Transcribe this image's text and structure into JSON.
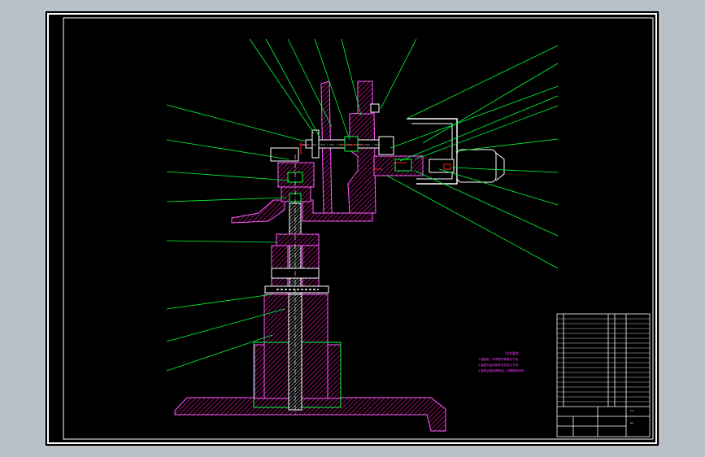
{
  "drawing": {
    "background": "#000000",
    "frame_color": "#ffffff",
    "leader_color": "#00ff3a",
    "section_color": "#b0127a",
    "outline_color": "#ff5cff",
    "part_color": "#ffffff",
    "dim_color": "#ff2020"
  },
  "tech_notes": {
    "title": "技术要求",
    "lines": [
      "1.装配前，所有零件需清洗干净。",
      "2.装配后运动部件应灵活无卡滞。",
      "3.各配合面涂润滑油，外露表面涂漆。"
    ]
  },
  "title_block": {
    "scale": "1:1",
    "sheet": "A1"
  }
}
